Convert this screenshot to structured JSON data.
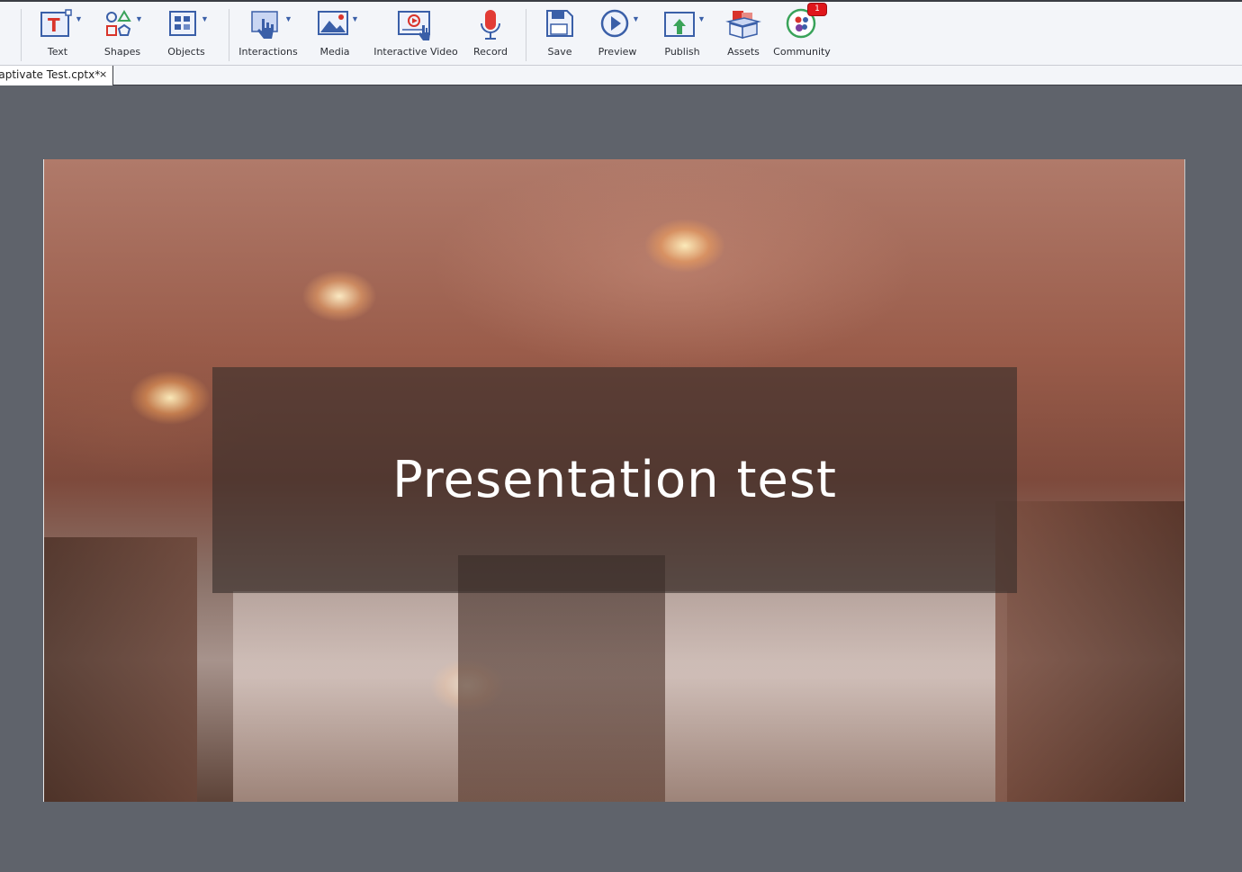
{
  "toolbar": {
    "text": "Text",
    "shapes": "Shapes",
    "objects": "Objects",
    "interactions": "Interactions",
    "media": "Media",
    "interactive_video": "Interactive Video",
    "record": "Record",
    "save": "Save",
    "preview": "Preview",
    "publish": "Publish",
    "assets": "Assets",
    "community": "Community",
    "community_badge": "1"
  },
  "tabs": {
    "document_name": "Captivate Test.cptx*",
    "close_glyph": "×"
  },
  "slide": {
    "title": "Presentation test"
  },
  "colors": {
    "accent": "#3a5fa8",
    "badge": "#e0161b",
    "stage": "#5f636b"
  }
}
